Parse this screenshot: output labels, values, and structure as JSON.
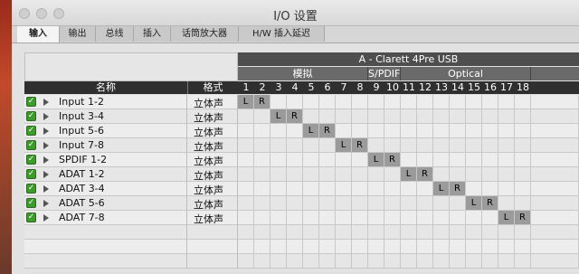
{
  "window": {
    "title": "I/O 设置"
  },
  "tabs": [
    {
      "label": "输入",
      "active": true
    },
    {
      "label": "输出",
      "active": false
    },
    {
      "label": "总线",
      "active": false
    },
    {
      "label": "插入",
      "active": false
    },
    {
      "label": "话筒放大器",
      "active": false
    },
    {
      "label": "H/W 插入延迟",
      "active": false
    }
  ],
  "device": {
    "name": "A - Clarett 4Pre USB"
  },
  "groups": [
    "模拟",
    "S/PDIF",
    "Optical"
  ],
  "columns": {
    "name": "名称",
    "format": "格式"
  },
  "channel_numbers": [
    "1",
    "2",
    "3",
    "4",
    "5",
    "6",
    "7",
    "8",
    "9",
    "10",
    "11",
    "12",
    "13",
    "14",
    "15",
    "16",
    "17",
    "18"
  ],
  "rows": [
    {
      "name": "Input 1-2",
      "format": "立体声",
      "checked": true,
      "start": 1
    },
    {
      "name": "Input 3-4",
      "format": "立体声",
      "checked": true,
      "start": 3
    },
    {
      "name": "Input 5-6",
      "format": "立体声",
      "checked": true,
      "start": 5
    },
    {
      "name": "Input 7-8",
      "format": "立体声",
      "checked": true,
      "start": 7
    },
    {
      "name": "SPDIF 1-2",
      "format": "立体声",
      "checked": true,
      "start": 9
    },
    {
      "name": "ADAT 1-2",
      "format": "立体声",
      "checked": true,
      "start": 11
    },
    {
      "name": "ADAT 3-4",
      "format": "立体声",
      "checked": true,
      "start": 13
    },
    {
      "name": "ADAT 5-6",
      "format": "立体声",
      "checked": true,
      "start": 15
    },
    {
      "name": "ADAT 7-8",
      "format": "立体声",
      "checked": true,
      "start": 17
    }
  ],
  "channel_labels": {
    "left": "L",
    "right": "R"
  },
  "colors": {
    "check": "#3d9b2a",
    "assigned": "#9b9b9b"
  }
}
